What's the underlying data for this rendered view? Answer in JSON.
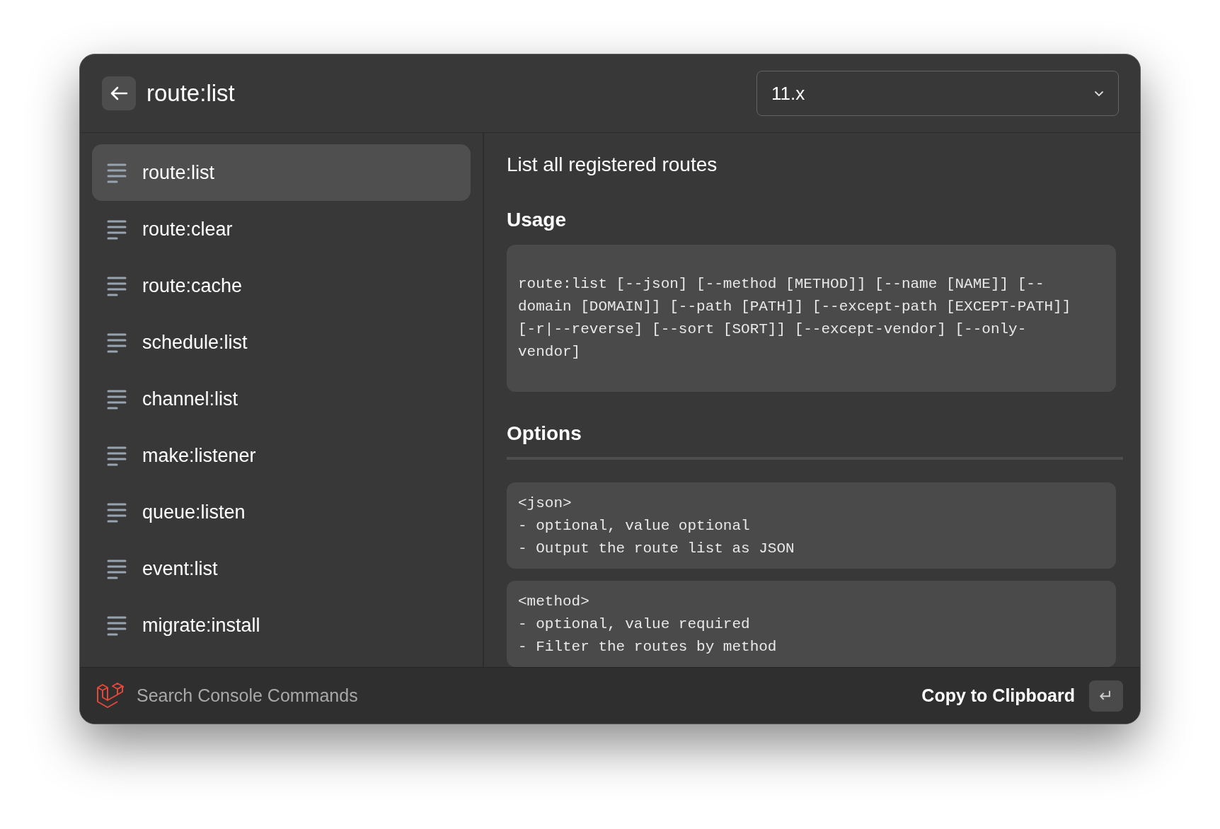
{
  "header": {
    "search_value": "route:list",
    "version": {
      "value": "11.x"
    }
  },
  "commands": [
    {
      "label": "route:list",
      "selected": true
    },
    {
      "label": "route:clear",
      "selected": false
    },
    {
      "label": "route:cache",
      "selected": false
    },
    {
      "label": "schedule:list",
      "selected": false
    },
    {
      "label": "channel:list",
      "selected": false
    },
    {
      "label": "make:listener",
      "selected": false
    },
    {
      "label": "queue:listen",
      "selected": false
    },
    {
      "label": "event:list",
      "selected": false
    },
    {
      "label": "migrate:install",
      "selected": false
    }
  ],
  "detail": {
    "description": "List all registered routes",
    "usage_heading": "Usage",
    "usage_lines": [
      "route:list [--json] [--method [METHOD]] [--name [NAME]] [--",
      "domain [DOMAIN]] [--path [PATH]] [--except-path [EXCEPT-PATH]]",
      "[-r|--reverse] [--sort [SORT]] [--except-vendor] [--only-",
      "vendor]"
    ],
    "options_heading": "Options",
    "options": [
      {
        "lines": [
          "<json>",
          "- optional, value optional",
          "- Output the route list as JSON"
        ]
      },
      {
        "lines": [
          "<method>",
          "- optional, value required",
          "- Filter the routes by method"
        ]
      }
    ]
  },
  "footer": {
    "title": "Search Console Commands",
    "action": "Copy to Clipboard",
    "key": "↵"
  }
}
